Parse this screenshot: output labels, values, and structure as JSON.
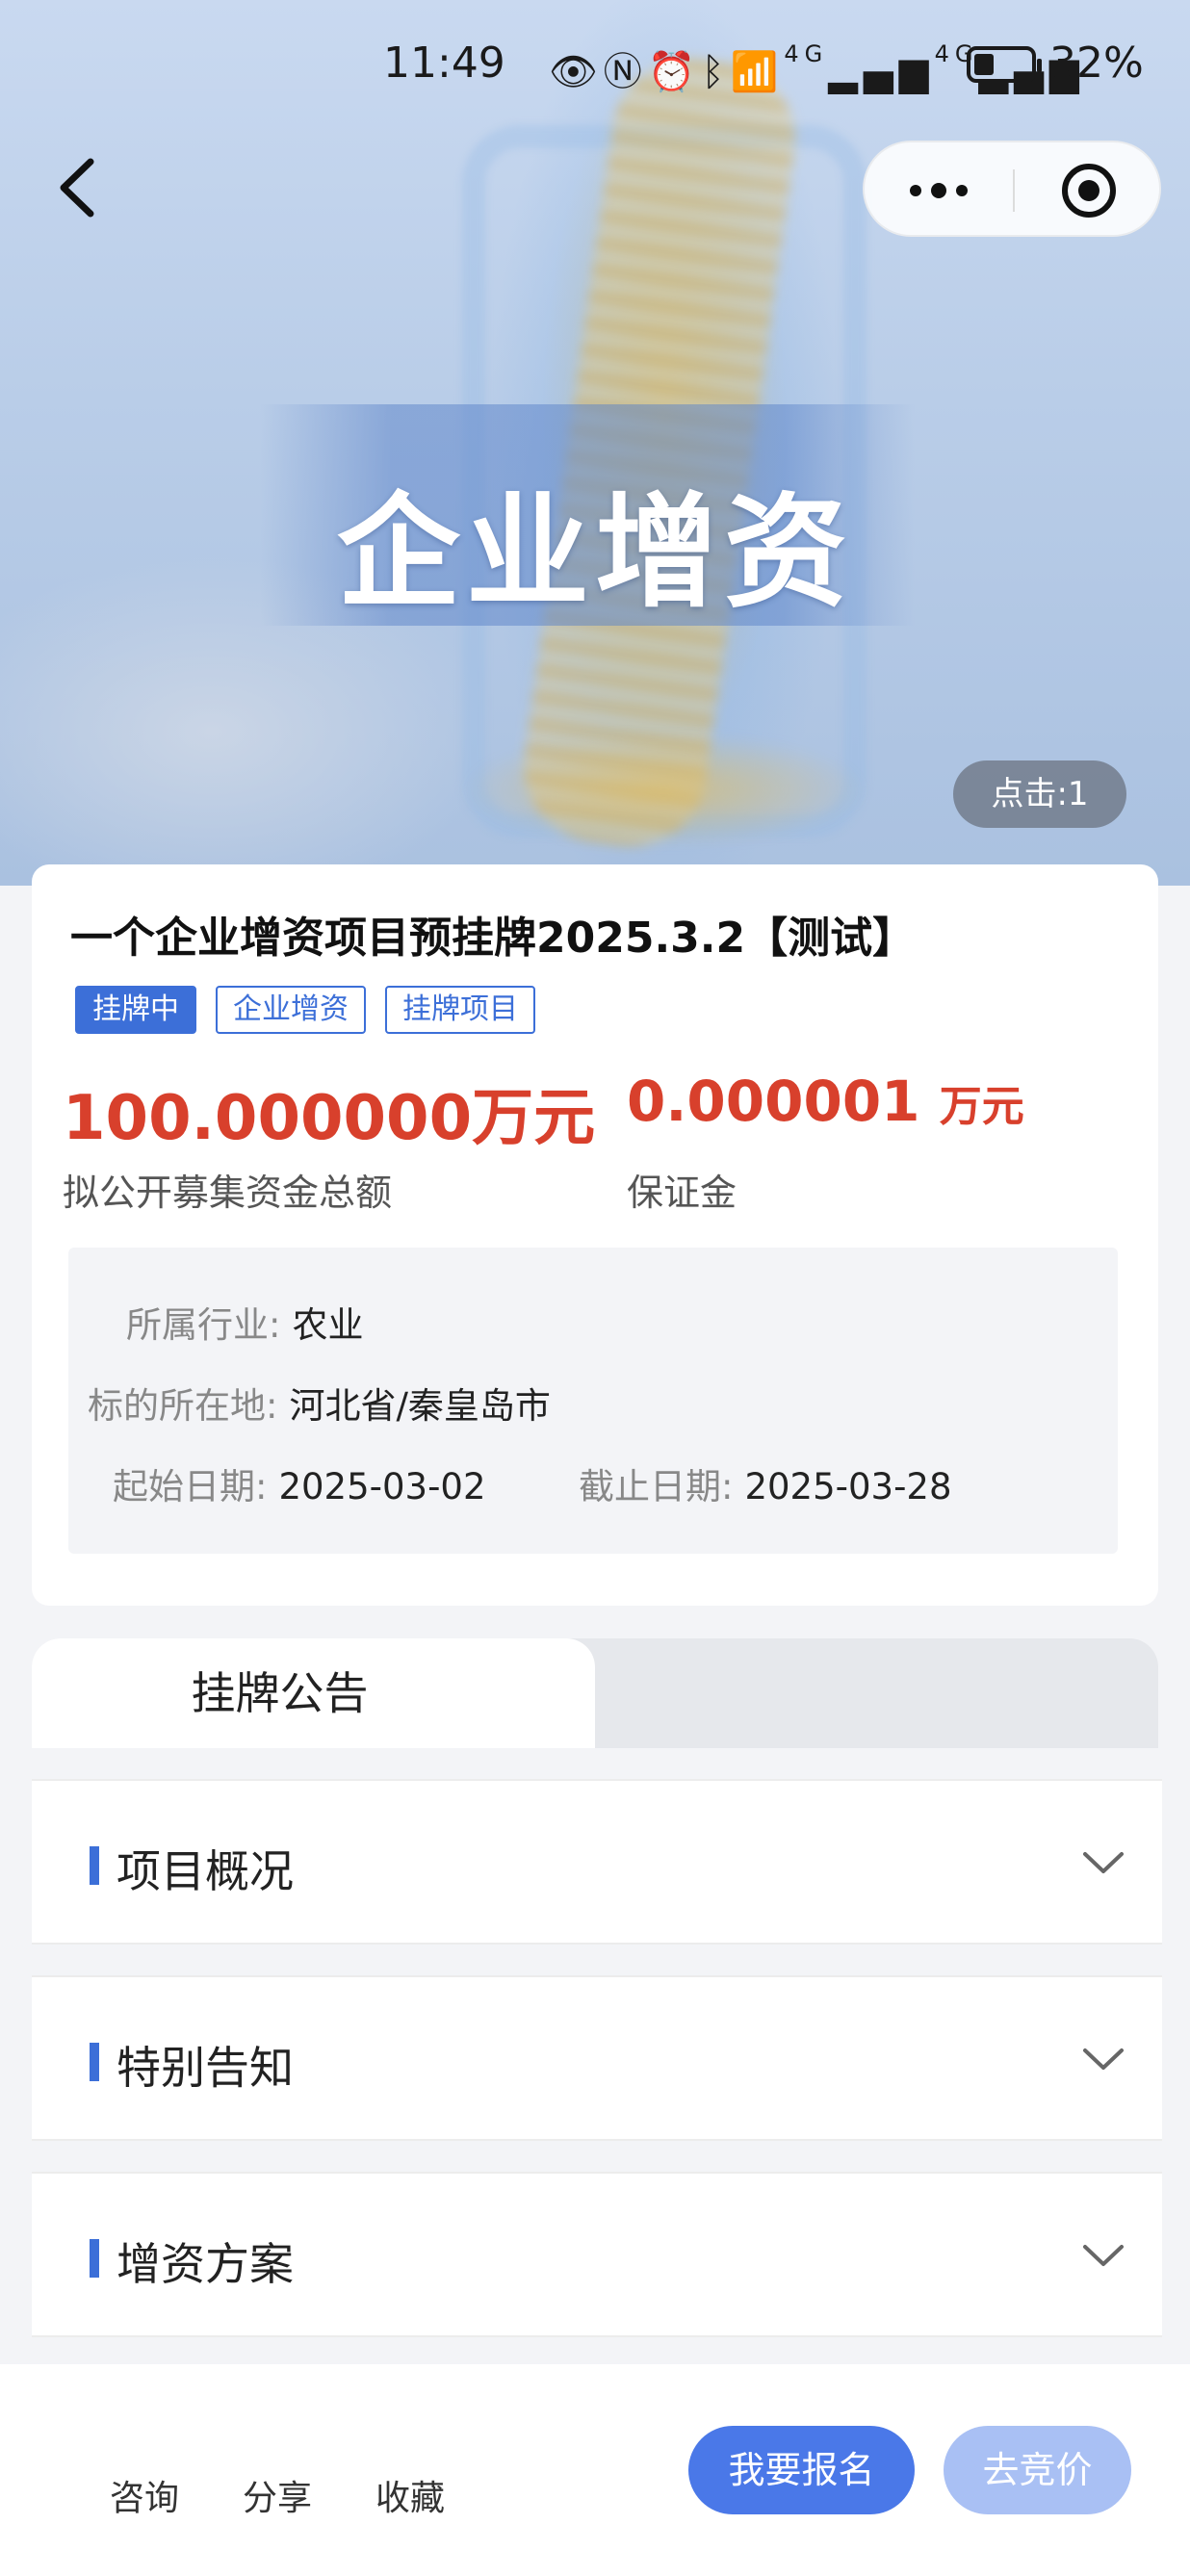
{
  "status_bar": {
    "time": "11:49",
    "icons": [
      "eye-icon",
      "nfc-icon",
      "alarm-icon",
      "bluetooth-icon",
      "wifi-icon",
      "signal-4g-icon",
      "signal-4g-icon",
      "battery-icon"
    ],
    "network_1": "4G",
    "network_2": "4G",
    "battery": "32%",
    "battery_level": 0.32
  },
  "hero": {
    "title": "企业增资",
    "clicks": "点击:1"
  },
  "project": {
    "title": "一个企业增资项目预挂牌2025.3.2【测试】",
    "tags": [
      "挂牌中",
      "企业增资",
      "挂牌项目"
    ],
    "amount_value": "100.000000万元",
    "amount_label": "拟公开募集资金总额",
    "deposit_value": "0.000001",
    "deposit_unit": "万元",
    "deposit_label": "保证金"
  },
  "details": {
    "industry_label": "所属行业:",
    "industry_value": "农业",
    "location_label": "标的所在地:",
    "location_value": "河北省/秦皇岛市",
    "start_label": "起始日期:",
    "start_value": "2025-03-02",
    "end_label": "截止日期:",
    "end_value": "2025-03-28"
  },
  "tabs": {
    "active": "挂牌公告"
  },
  "sections": [
    {
      "title": "项目概况"
    },
    {
      "title": "特别告知"
    },
    {
      "title": "增资方案"
    }
  ],
  "bottom_bar": {
    "consult": "咨询",
    "share": "分享",
    "favorite": "收藏",
    "signup": "我要报名",
    "bid": "去竞价"
  },
  "colors": {
    "accent_blue": "#3c6fd8",
    "primary_button": "#4a78e8",
    "disabled_button": "#a9c0f4",
    "price_red": "#d8402c"
  }
}
